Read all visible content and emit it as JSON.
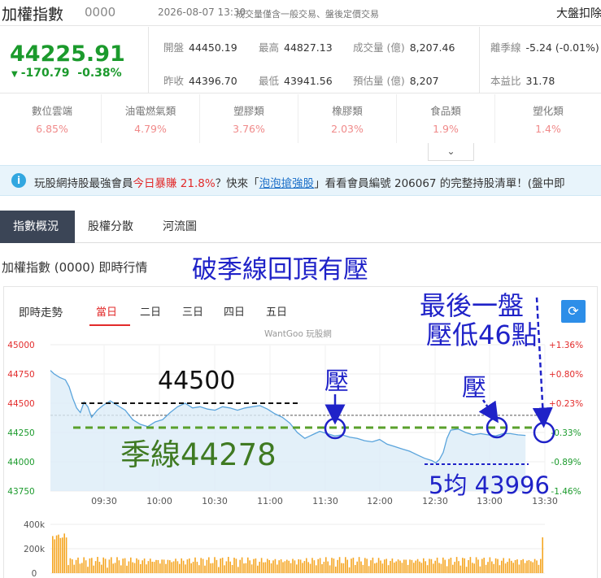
{
  "header": {
    "title": "加權指數",
    "code": "0000",
    "timestamp": "2026-08-07 13:30",
    "note": "成交量僅含一般交易、盤後定價交易",
    "right_link": "大盤扣除"
  },
  "quote": {
    "price": "44225.91",
    "change": "-170.79",
    "change_pct": "-0.38%",
    "stats": [
      {
        "label": "開盤",
        "value": "44450.19"
      },
      {
        "label": "最高",
        "value": "44827.13"
      },
      {
        "label": "成交量 (億)",
        "value": "8,207.46"
      },
      {
        "label": "離季線",
        "value": "-5.24 (-0.01%)"
      },
      {
        "label": "昨收",
        "value": "44396.70"
      },
      {
        "label": "最低",
        "value": "43941.56"
      },
      {
        "label": "預估量 (億)",
        "value": "8,207"
      },
      {
        "label": "本益比",
        "value": "31.78"
      }
    ]
  },
  "sectors": [
    {
      "name": "數位雲端",
      "value": "6.85%"
    },
    {
      "name": "油電燃氣類",
      "value": "4.79%"
    },
    {
      "name": "塑膠類",
      "value": "3.76%"
    },
    {
      "name": "橡膠類",
      "value": "2.03%"
    },
    {
      "name": "食品類",
      "value": "1.9%"
    },
    {
      "name": "塑化類",
      "value": "1.4%"
    }
  ],
  "banner": {
    "t1": "玩股網持股最強會員",
    "t2": "今日暴賺 21.8%",
    "t3": "？快來「",
    "link": "泡泡搶強股",
    "t4": "」看看會員編號 206067 的完整持股清單！(盤中即",
    "accent": "#e22a2a"
  },
  "tabs": [
    "指數概況",
    "股權分散",
    "河流圖"
  ],
  "section_title": "加權指數 (0000) 即時行情",
  "annotations": {
    "headline": "破季線回頂有壓",
    "last_note_1": "最後一盤",
    "last_note_2": "壓低46點",
    "level_44500": "44500",
    "quarter_line": "季線44278",
    "pressure_1": "壓",
    "pressure_2": "壓",
    "ma5": "5均 43996"
  },
  "chart_panel": {
    "title": "即時走勢",
    "ranges": [
      "當日",
      "二日",
      "三日",
      "四日",
      "五日"
    ],
    "active_range": "當日",
    "watermark": "WantGoo 玩股網"
  },
  "chart_data": {
    "type": "line",
    "x_ticks": [
      "09:30",
      "10:00",
      "10:30",
      "11:00",
      "11:30",
      "12:00",
      "12:30",
      "13:00",
      "13:30"
    ],
    "y_ticks": [
      "45000",
      "44750",
      "44500",
      "44250",
      "44000",
      "43750"
    ],
    "pct_ticks": [
      "+1.36%",
      "+0.80%",
      "+0.23%",
      "-0.33%",
      "-0.89%",
      "-1.46%"
    ],
    "ylim": [
      43750,
      45000
    ],
    "prev_close": 44396.7,
    "quarter_ma": 44278,
    "series": [
      {
        "values": [
          [
            0,
            44780
          ],
          [
            2,
            44750
          ],
          [
            5,
            44720
          ],
          [
            8,
            44700
          ],
          [
            10,
            44640
          ],
          [
            12,
            44540
          ],
          [
            14,
            44460
          ],
          [
            16,
            44420
          ],
          [
            18,
            44510
          ],
          [
            20,
            44470
          ],
          [
            22,
            44380
          ],
          [
            25,
            44440
          ],
          [
            28,
            44480
          ],
          [
            32,
            44520
          ],
          [
            36,
            44480
          ],
          [
            40,
            44440
          ],
          [
            44,
            44360
          ],
          [
            48,
            44320
          ],
          [
            52,
            44300
          ],
          [
            56,
            44340
          ],
          [
            60,
            44360
          ],
          [
            64,
            44420
          ],
          [
            68,
            44470
          ],
          [
            72,
            44500
          ],
          [
            76,
            44460
          ],
          [
            80,
            44470
          ],
          [
            84,
            44450
          ],
          [
            88,
            44440
          ],
          [
            92,
            44470
          ],
          [
            96,
            44460
          ],
          [
            100,
            44440
          ],
          [
            104,
            44460
          ],
          [
            108,
            44470
          ],
          [
            112,
            44480
          ],
          [
            116,
            44450
          ],
          [
            120,
            44410
          ],
          [
            124,
            44380
          ],
          [
            128,
            44330
          ],
          [
            132,
            44250
          ],
          [
            136,
            44200
          ],
          [
            140,
            44230
          ],
          [
            144,
            44260
          ],
          [
            148,
            44240
          ],
          [
            152,
            44220
          ],
          [
            156,
            44230
          ],
          [
            160,
            44210
          ],
          [
            164,
            44200
          ],
          [
            168,
            44180
          ],
          [
            172,
            44170
          ],
          [
            176,
            44190
          ],
          [
            180,
            44150
          ],
          [
            184,
            44130
          ],
          [
            188,
            44110
          ],
          [
            192,
            44090
          ],
          [
            196,
            44060
          ],
          [
            200,
            44030
          ],
          [
            204,
            44010
          ],
          [
            206,
            43990
          ],
          [
            208,
            44020
          ],
          [
            210,
            44080
          ],
          [
            212,
            44200
          ],
          [
            214,
            44270
          ],
          [
            218,
            44280
          ],
          [
            222,
            44250
          ],
          [
            226,
            44230
          ],
          [
            230,
            44240
          ],
          [
            234,
            44230
          ],
          [
            238,
            44220
          ],
          [
            242,
            44240
          ],
          [
            246,
            44240
          ],
          [
            250,
            44230
          ],
          [
            254,
            44225
          ]
        ]
      }
    ],
    "volume": {
      "ylim": [
        0,
        400
      ],
      "y_ticks": [
        "400k",
        "200k",
        "0"
      ]
    }
  }
}
